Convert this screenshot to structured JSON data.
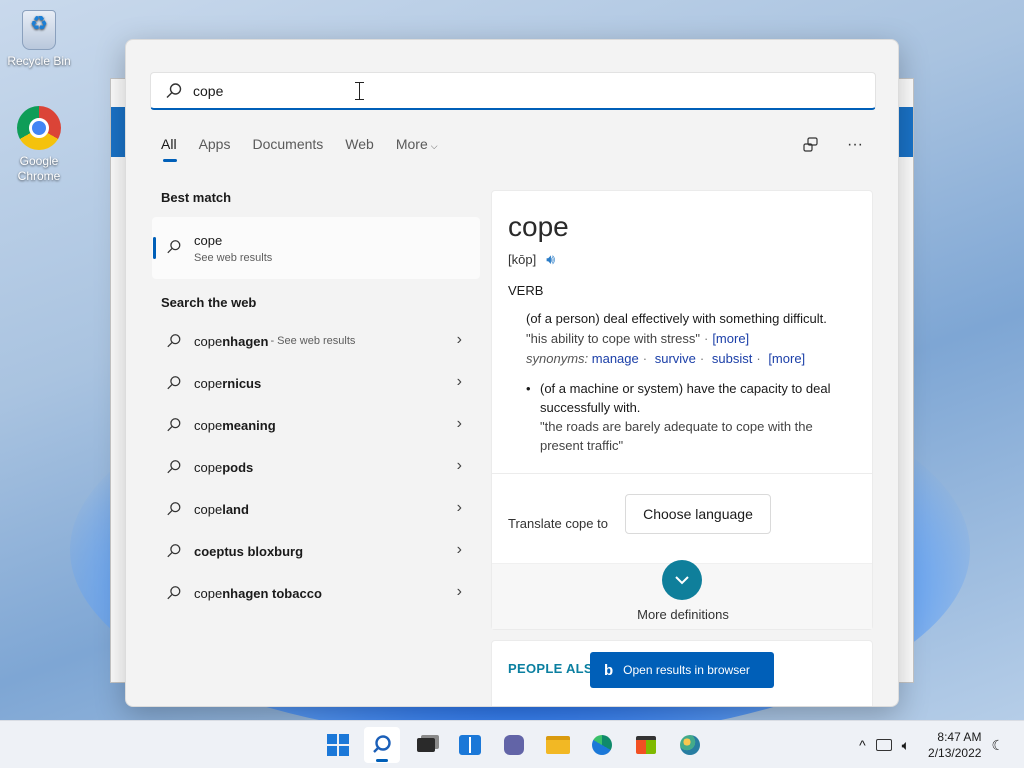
{
  "desktop": {
    "icons": [
      {
        "label": "Recycle Bin",
        "icon": "recycle-bin-icon"
      },
      {
        "label": "Google Chrome",
        "icon": "chrome-icon"
      }
    ]
  },
  "search": {
    "query": "cope",
    "placeholder": ""
  },
  "tabs": [
    {
      "label": "All",
      "active": true
    },
    {
      "label": "Apps"
    },
    {
      "label": "Documents"
    },
    {
      "label": "Web"
    },
    {
      "label": "More",
      "chevron": "⌵"
    }
  ],
  "tools": {
    "share_icon": "⧉",
    "more_icon": "···"
  },
  "best_match": {
    "section_title": "Best match",
    "title": "cope",
    "subtitle": "See web results"
  },
  "web": {
    "section_title": "Search the web",
    "items": [
      {
        "prefix": "cope",
        "bold": "nhagen",
        "hint": "- See web results"
      },
      {
        "prefix": "cope",
        "bold": "rnicus",
        "hint": ""
      },
      {
        "prefix": "cope",
        "bold": " meaning",
        "hint": ""
      },
      {
        "prefix": "cope",
        "bold": "pods",
        "hint": ""
      },
      {
        "prefix": "cope",
        "bold": "land",
        "hint": ""
      },
      {
        "prefix": "",
        "bold": "coeptus bloxburg",
        "hint": ""
      },
      {
        "prefix": "cope",
        "bold": "nhagen tobacco",
        "hint": ""
      }
    ]
  },
  "dictionary": {
    "word": "cope",
    "pronunciation": "[kōp]",
    "part_of_speech": "VERB",
    "def1": "(of a person) deal effectively with something difficult.",
    "def1_example": "\"his ability to cope with stress\"",
    "more_label": "[more]",
    "synonyms_label": "synonyms:",
    "synonyms": [
      "manage",
      "survive",
      "subsist"
    ],
    "def2": "(of a machine or system) have the capacity to deal successfully with.",
    "def2_example": "\"the roads are barely adequate to cope with the present traffic\"",
    "translate_label": "Translate cope to",
    "choose_language": "Choose language",
    "more_definitions": "More definitions"
  },
  "people_also": {
    "title": "PEOPLE ALSO"
  },
  "open_browser": {
    "label": "Open results in browser"
  },
  "taskbar": {
    "clock_time": "8:47 AM",
    "clock_date": "2/13/2022",
    "tray_chevron": "^"
  },
  "colors": {
    "accent": "#005fb8",
    "link": "#1b3fa8",
    "teal": "#0f7f9b"
  }
}
